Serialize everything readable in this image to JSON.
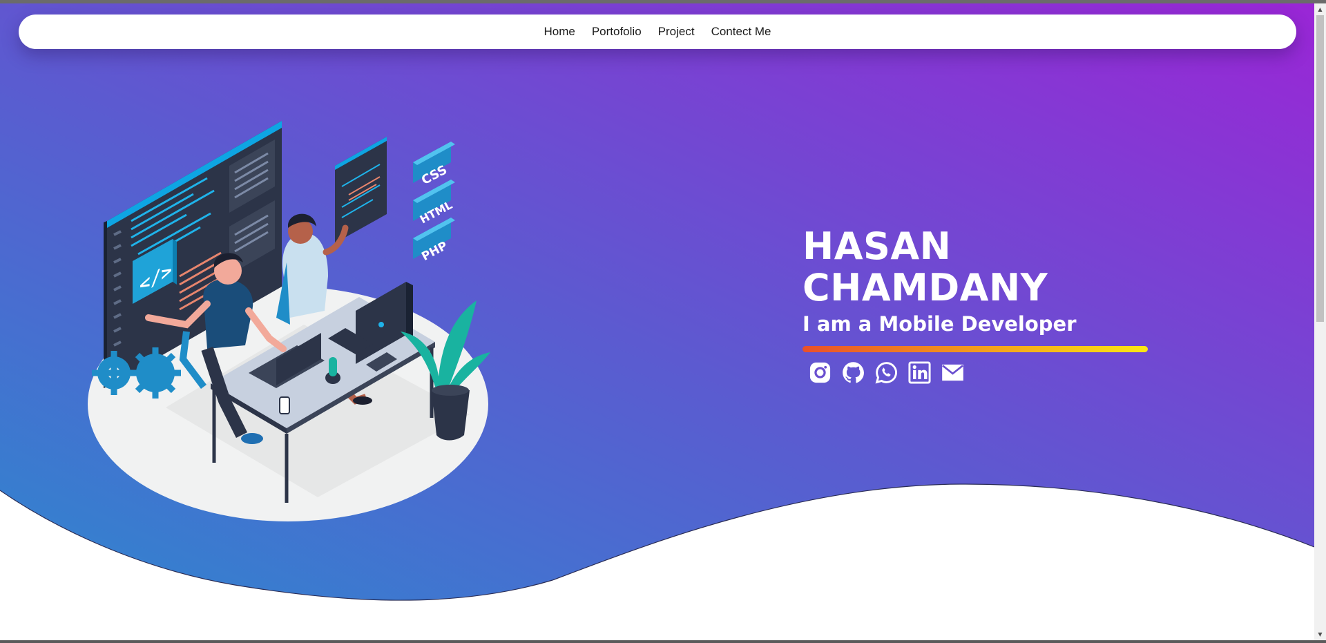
{
  "nav": {
    "items": [
      {
        "label": "Home"
      },
      {
        "label": "Portofolio"
      },
      {
        "label": "Project"
      },
      {
        "label": "Contect Me"
      }
    ]
  },
  "hero": {
    "name_line1": "HASAN",
    "name_line2": "CHAMDANY",
    "tagline": "I am a Mobile Developer",
    "gradient_start": "#2f86cf",
    "gradient_mid": "#5b5bd0",
    "gradient_end": "#9a26d6",
    "underline_colors": [
      "#e9502a",
      "#f5a21b",
      "#fde713"
    ],
    "illustration_badges": [
      "CSS",
      "HTML",
      "PHP"
    ]
  },
  "socials": [
    {
      "icon": "instagram-icon"
    },
    {
      "icon": "github-icon"
    },
    {
      "icon": "whatsapp-icon"
    },
    {
      "icon": "linkedin-icon"
    },
    {
      "icon": "email-icon"
    }
  ],
  "scrollbar": {
    "up_arrow": "▲",
    "down_arrow": "▼"
  }
}
